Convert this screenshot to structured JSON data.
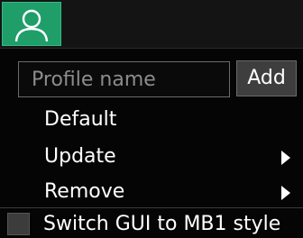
{
  "profile_tab": {
    "icon": "user-icon",
    "accent": "#1f9e6a"
  },
  "menu": {
    "input_placeholder": "Profile name",
    "input_value": "",
    "add_label": "Add",
    "items": [
      {
        "label": "Default",
        "icon": ""
      },
      {
        "label": "Update",
        "icon": "chevron-right-icon"
      },
      {
        "label": "Remove",
        "icon": "chevron-right-icon"
      }
    ],
    "switch": {
      "label": "Switch GUI to MB1 style",
      "checked": false
    }
  }
}
